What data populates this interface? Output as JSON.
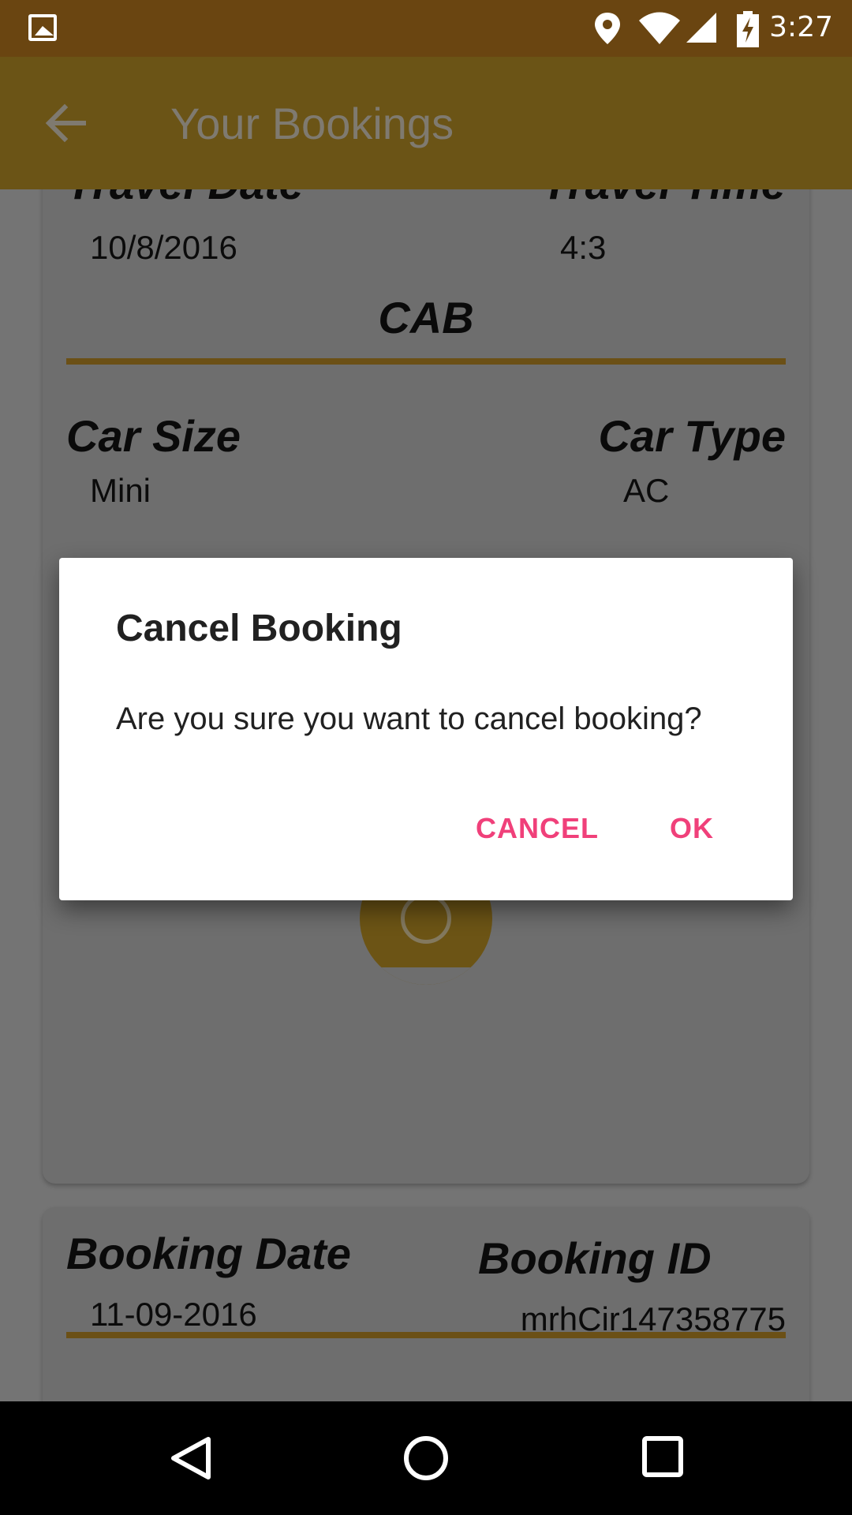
{
  "status_bar": {
    "time": "3:27"
  },
  "app_bar": {
    "title": "Your Bookings"
  },
  "booking_card": {
    "travel_date_label": "Travel Date",
    "travel_date": "10/8/2016",
    "travel_time_label": "Travel Time",
    "travel_time": "4:3",
    "section_title": "CAB",
    "car_size_label": "Car Size",
    "car_size": "Mini",
    "car_type_label": "Car Type",
    "car_type": "AC"
  },
  "second_card": {
    "booking_date_label": "Booking Date",
    "booking_date": "11-09-2016",
    "booking_id_label": "Booking ID",
    "booking_id": "mrhCir147358775"
  },
  "dialog": {
    "title": "Cancel Booking",
    "message": "Are you sure you want to cancel booking?",
    "cancel_label": "CANCEL",
    "ok_label": "OK"
  },
  "colors": {
    "status_bar": "#6a4511",
    "app_bar": "#6b5416",
    "accent_button_text": "#f0407a",
    "cancel_fab": "#6b0f1c"
  },
  "icons": {
    "status": [
      "image-icon",
      "location-icon",
      "wifi-icon",
      "signal-icon",
      "battery-charging-icon"
    ],
    "nav": [
      "back-triangle-icon",
      "home-circle-icon",
      "recents-square-icon"
    ]
  }
}
